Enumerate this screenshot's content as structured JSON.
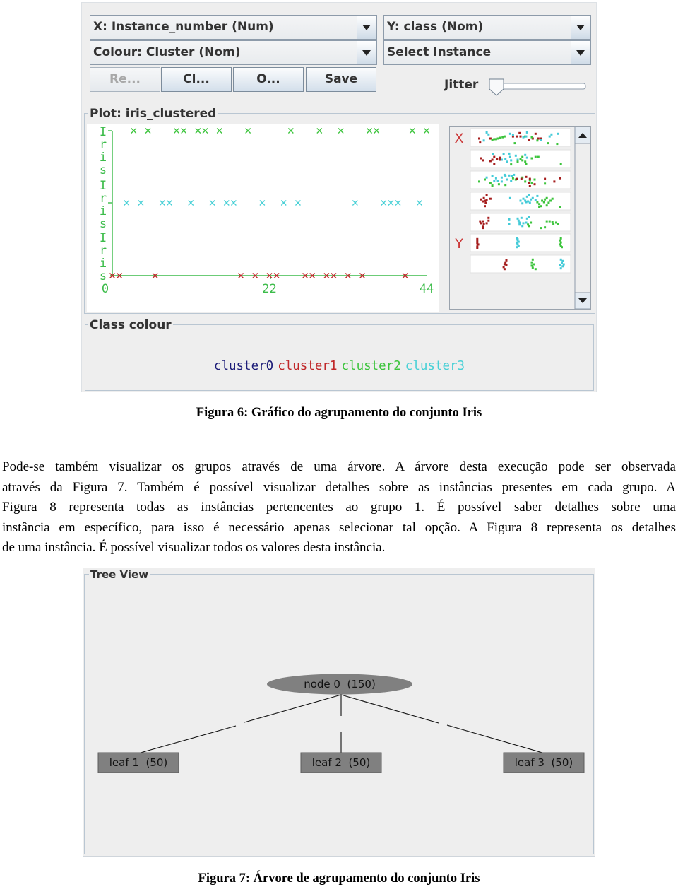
{
  "weka_plot": {
    "x_combo": "X: Instance_number (Num)",
    "y_combo": "Y: class (Nom)",
    "colour_combo": "Colour: Cluster (Nom)",
    "instance_combo": "Select Instance",
    "buttons": {
      "reset": "Re...",
      "clear": "Cl...",
      "open": "O...",
      "save": "Save"
    },
    "jitter_label": "Jitter",
    "jitter_value": 0,
    "plot_title": "Plot: iris_clustered",
    "class_colour_title": "Class colour",
    "legend": [
      {
        "label": "cluster0",
        "color": "#1c1c78"
      },
      {
        "label": "cluster1",
        "color": "#c0282a"
      },
      {
        "label": "cluster2",
        "color": "#3cc43c"
      },
      {
        "label": "cluster3",
        "color": "#48d0d6"
      }
    ]
  },
  "chart_data": {
    "type": "scatter",
    "title": "Plot: iris_clustered",
    "xlabel": "Instance_number",
    "ylabel": "class",
    "xlim": [
      0,
      44
    ],
    "x_ticks": [
      "0",
      "22",
      "44"
    ],
    "y_categories": [
      "Iris",
      "Iris",
      "Iris"
    ],
    "y_categories_order": "bottom-to-top",
    "marker": "x",
    "grid": false,
    "legend": "bottom",
    "series": [
      {
        "name": "cluster1",
        "color": "#c0282a",
        "y_index": 0,
        "x": [
          0,
          1,
          6,
          18,
          20,
          22,
          23,
          27,
          28,
          30,
          31,
          33,
          35,
          41
        ]
      },
      {
        "name": "cluster3",
        "color": "#48d0d6",
        "y_index": 1,
        "x": [
          2,
          4,
          7,
          8,
          11,
          14,
          16,
          17,
          21,
          24,
          26,
          34,
          38,
          39,
          40,
          43
        ]
      },
      {
        "name": "cluster2",
        "color": "#3cc43c",
        "y_index": 2,
        "x": [
          3,
          5,
          9,
          10,
          12,
          13,
          15,
          19,
          25,
          29,
          32,
          36,
          37,
          42,
          44
        ]
      }
    ]
  },
  "matrix": {
    "colors": {
      "1": "#a51d1d",
      "2": "#3cc43c",
      "3": "#44cbd8"
    },
    "strips": [
      {
        "axis_label": "X",
        "points": [
          [
            0.06,
            0.55,
            1
          ],
          [
            0.07,
            0.85,
            1
          ],
          [
            0.18,
            0.55,
            1
          ],
          [
            0.42,
            0.4,
            1
          ],
          [
            0.46,
            0.4,
            1
          ],
          [
            0.5,
            0.4,
            1
          ],
          [
            0.59,
            0.65,
            1
          ],
          [
            0.63,
            0.55,
            1
          ],
          [
            0.66,
            0.2,
            1
          ],
          [
            0.69,
            0.55,
            1
          ],
          [
            0.72,
            0.55,
            1
          ],
          [
            0.49,
            0.15,
            1
          ],
          [
            0.2,
            0.65,
            2
          ],
          [
            0.22,
            0.6,
            2
          ],
          [
            0.24,
            0.6,
            2
          ],
          [
            0.26,
            0.55,
            2
          ],
          [
            0.28,
            0.5,
            2
          ],
          [
            0.31,
            0.45,
            2
          ],
          [
            0.33,
            0.4,
            2
          ],
          [
            0.44,
            0.9,
            2
          ],
          [
            0.55,
            0.4,
            2
          ],
          [
            0.62,
            0.45,
            2
          ],
          [
            0.79,
            0.9,
            2
          ],
          [
            0.89,
            0.95,
            2
          ],
          [
            0.68,
            0.7,
            2
          ],
          [
            0.14,
            0.1,
            3
          ],
          [
            0.16,
            0.25,
            3
          ],
          [
            0.11,
            0.7,
            3
          ],
          [
            0.39,
            0.2,
            3
          ],
          [
            0.42,
            0.3,
            3
          ],
          [
            0.57,
            0.1,
            3
          ],
          [
            0.56,
            0.4,
            3
          ],
          [
            0.72,
            0.65,
            3
          ],
          [
            0.81,
            0.4,
            3
          ],
          [
            0.83,
            0.25,
            3
          ],
          [
            0.9,
            0.2,
            3
          ],
          [
            0.53,
            0.45,
            3
          ]
        ]
      },
      {
        "axis_label": "",
        "points": [
          [
            0.08,
            0.45,
            1
          ],
          [
            0.1,
            0.6,
            1
          ],
          [
            0.18,
            0.65,
            1
          ],
          [
            0.2,
            0.55,
            1
          ],
          [
            0.22,
            0.35,
            1
          ],
          [
            0.25,
            0.5,
            1
          ],
          [
            0.28,
            0.55,
            1
          ],
          [
            0.22,
            0.85,
            1
          ],
          [
            0.28,
            0.4,
            1
          ],
          [
            0.21,
            0.15,
            3
          ],
          [
            0.32,
            0.15,
            3
          ],
          [
            0.38,
            0.1,
            3
          ],
          [
            0.39,
            0.35,
            3
          ],
          [
            0.34,
            0.5,
            3
          ],
          [
            0.45,
            0.25,
            3
          ],
          [
            0.47,
            0.55,
            3
          ],
          [
            0.55,
            0.2,
            3
          ],
          [
            0.57,
            0.4,
            3
          ],
          [
            0.4,
            0.6,
            3
          ],
          [
            0.36,
            0.7,
            3
          ],
          [
            0.3,
            0.55,
            3
          ],
          [
            0.47,
            0.7,
            2
          ],
          [
            0.52,
            0.6,
            2
          ],
          [
            0.55,
            0.7,
            2
          ],
          [
            0.56,
            0.85,
            2
          ],
          [
            0.52,
            0.35,
            2
          ],
          [
            0.62,
            0.45,
            2
          ],
          [
            0.66,
            0.35,
            2
          ],
          [
            0.69,
            0.35,
            2
          ],
          [
            0.4,
            0.9,
            2
          ],
          [
            0.93,
            0.85,
            2
          ],
          [
            0.5,
            0.5,
            2
          ]
        ]
      },
      {
        "axis_label": "",
        "points": [
          [
            0.06,
            0.6,
            2
          ],
          [
            0.12,
            0.45,
            2
          ],
          [
            0.18,
            0.7,
            2
          ],
          [
            0.27,
            0.8,
            2
          ],
          [
            0.42,
            0.35,
            2
          ],
          [
            0.45,
            0.45,
            2
          ],
          [
            0.52,
            0.3,
            2
          ],
          [
            0.55,
            0.6,
            2
          ],
          [
            0.6,
            0.5,
            2
          ],
          [
            0.62,
            0.7,
            2
          ],
          [
            0.65,
            0.45,
            2
          ],
          [
            0.76,
            0.75,
            2
          ],
          [
            0.2,
            0.9,
            2
          ],
          [
            0.34,
            0.85,
            2
          ],
          [
            0.14,
            0.3,
            3
          ],
          [
            0.2,
            0.2,
            3
          ],
          [
            0.24,
            0.35,
            3
          ],
          [
            0.3,
            0.3,
            3
          ],
          [
            0.33,
            0.1,
            3
          ],
          [
            0.34,
            0.2,
            3
          ],
          [
            0.38,
            0.15,
            3
          ],
          [
            0.43,
            0.1,
            3
          ],
          [
            0.41,
            0.2,
            3
          ],
          [
            0.36,
            0.45,
            3
          ],
          [
            0.3,
            0.6,
            3
          ],
          [
            0.26,
            0.55,
            3
          ],
          [
            0.22,
            0.55,
            3
          ],
          [
            0.4,
            0.55,
            3
          ],
          [
            0.46,
            0.4,
            1
          ],
          [
            0.51,
            0.4,
            1
          ],
          [
            0.56,
            0.25,
            1
          ],
          [
            0.6,
            0.4,
            1
          ],
          [
            0.59,
            0.7,
            1
          ],
          [
            0.76,
            0.4,
            1
          ],
          [
            0.92,
            0.35,
            1
          ],
          [
            0.86,
            0.6,
            1
          ],
          [
            0.6,
            0.95,
            1
          ],
          [
            0.65,
            0.8,
            1
          ]
        ]
      },
      {
        "axis_label": "",
        "points": [
          [
            0.08,
            0.35,
            1
          ],
          [
            0.1,
            0.5,
            1
          ],
          [
            0.12,
            0.45,
            1
          ],
          [
            0.11,
            0.25,
            1
          ],
          [
            0.14,
            0.4,
            1
          ],
          [
            0.13,
            0.6,
            1
          ],
          [
            0.18,
            0.3,
            1
          ],
          [
            0.12,
            0.85,
            1
          ],
          [
            0.14,
            0.05,
            1
          ],
          [
            0.39,
            0.25,
            3
          ],
          [
            0.5,
            0.45,
            3
          ],
          [
            0.53,
            0.3,
            3
          ],
          [
            0.55,
            0.45,
            3
          ],
          [
            0.57,
            0.15,
            3
          ],
          [
            0.59,
            0.05,
            3
          ],
          [
            0.61,
            0.35,
            3
          ],
          [
            0.63,
            0.25,
            3
          ],
          [
            0.52,
            0.65,
            3
          ],
          [
            0.56,
            0.55,
            3
          ],
          [
            0.6,
            0.6,
            3
          ],
          [
            0.66,
            0.4,
            3
          ],
          [
            0.68,
            0.1,
            3
          ],
          [
            0.58,
            0.5,
            3
          ],
          [
            0.68,
            0.55,
            2
          ],
          [
            0.7,
            0.7,
            2
          ],
          [
            0.73,
            0.45,
            2
          ],
          [
            0.75,
            0.55,
            2
          ],
          [
            0.76,
            0.35,
            2
          ],
          [
            0.78,
            0.25,
            2
          ],
          [
            0.8,
            0.6,
            2
          ],
          [
            0.82,
            0.45,
            2
          ],
          [
            0.84,
            0.3,
            2
          ],
          [
            0.72,
            0.85,
            2
          ],
          [
            0.7,
            0.9,
            2
          ],
          [
            0.92,
            0.9,
            2
          ],
          [
            0.78,
            0.8,
            2
          ]
        ]
      },
      {
        "axis_label": "",
        "points": [
          [
            0.07,
            0.4,
            1
          ],
          [
            0.08,
            0.55,
            1
          ],
          [
            0.1,
            0.4,
            1
          ],
          [
            0.11,
            0.6,
            1
          ],
          [
            0.1,
            0.8,
            1
          ],
          [
            0.14,
            0.55,
            1
          ],
          [
            0.16,
            0.35,
            1
          ],
          [
            0.16,
            0.15,
            1
          ],
          [
            0.1,
            0.9,
            1
          ],
          [
            0.38,
            0.25,
            3
          ],
          [
            0.38,
            0.6,
            3
          ],
          [
            0.47,
            0.2,
            3
          ],
          [
            0.48,
            0.35,
            3
          ],
          [
            0.49,
            0.5,
            3
          ],
          [
            0.49,
            0.65,
            3
          ],
          [
            0.51,
            0.15,
            3
          ],
          [
            0.53,
            0.55,
            3
          ],
          [
            0.56,
            0.5,
            3
          ],
          [
            0.57,
            0.2,
            3
          ],
          [
            0.59,
            0.05,
            3
          ],
          [
            0.52,
            0.75,
            3
          ],
          [
            0.58,
            0.65,
            2
          ],
          [
            0.59,
            0.75,
            2
          ],
          [
            0.61,
            0.5,
            2
          ],
          [
            0.78,
            0.4,
            2
          ],
          [
            0.81,
            0.4,
            2
          ],
          [
            0.84,
            0.45,
            2
          ],
          [
            0.85,
            0.6,
            2
          ],
          [
            0.88,
            0.5,
            2
          ],
          [
            0.72,
            0.9,
            2
          ],
          [
            0.76,
            0.85,
            2
          ],
          [
            0.9,
            0.6,
            2
          ]
        ]
      },
      {
        "axis_label": "Y",
        "points": [
          [
            0.04,
            0.2,
            1
          ],
          [
            0.04,
            0.35,
            1
          ],
          [
            0.04,
            0.5,
            1
          ],
          [
            0.05,
            0.6,
            1
          ],
          [
            0.04,
            0.75,
            1
          ],
          [
            0.04,
            0.85,
            1
          ],
          [
            0.46,
            0.15,
            3
          ],
          [
            0.47,
            0.3,
            3
          ],
          [
            0.48,
            0.4,
            3
          ],
          [
            0.46,
            0.5,
            3
          ],
          [
            0.47,
            0.6,
            3
          ],
          [
            0.48,
            0.7,
            3
          ],
          [
            0.46,
            0.8,
            3
          ],
          [
            0.47,
            0.22,
            3
          ],
          [
            0.93,
            0.15,
            2
          ],
          [
            0.92,
            0.3,
            2
          ],
          [
            0.93,
            0.45,
            2
          ],
          [
            0.92,
            0.6,
            2
          ],
          [
            0.93,
            0.7,
            2
          ],
          [
            0.94,
            0.8,
            2
          ]
        ]
      },
      {
        "axis_label": "",
        "points": [
          [
            0.35,
            0.2,
            1
          ],
          [
            0.34,
            0.35,
            1
          ],
          [
            0.33,
            0.5,
            1
          ],
          [
            0.35,
            0.55,
            1
          ],
          [
            0.32,
            0.7,
            1
          ],
          [
            0.33,
            0.85,
            1
          ],
          [
            0.63,
            0.15,
            2
          ],
          [
            0.62,
            0.35,
            2
          ],
          [
            0.64,
            0.5,
            2
          ],
          [
            0.62,
            0.6,
            2
          ],
          [
            0.63,
            0.75,
            2
          ],
          [
            0.66,
            0.85,
            2
          ],
          [
            0.93,
            0.15,
            3
          ],
          [
            0.95,
            0.25,
            3
          ],
          [
            0.94,
            0.4,
            3
          ],
          [
            0.92,
            0.55,
            3
          ],
          [
            0.95,
            0.65,
            3
          ],
          [
            0.93,
            0.8,
            3
          ],
          [
            0.96,
            0.5,
            3
          ]
        ]
      }
    ]
  },
  "document": {
    "figure6_caption": "Figura 6: Gráfico do agrupamento do conjunto Iris",
    "paragraph_lines": [
      "Pode-se também visualizar os grupos através de uma árvore. A árvore desta execução pode ser observada",
      "através da Figura 7. Também é possível visualizar detalhes sobre as instâncias presentes em cada grupo. A",
      "Figura 8 representa todas as instâncias pertencentes ao grupo 1. É possível saber detalhes sobre uma",
      "instância em específico, para isso é necessário apenas selecionar tal opção. A Figura 8 representa os detalhes",
      "de uma instância. É possível visualizar todos os valores desta instância."
    ],
    "figure7_caption": "Figura 7: Árvore de agrupamento do conjunto Iris"
  },
  "tree_view": {
    "title": "Tree View",
    "root": {
      "label": "node 0  (150)",
      "color": "#808080"
    },
    "leaves": [
      {
        "label": "leaf 1  (50)"
      },
      {
        "label": "leaf 2  (50)"
      },
      {
        "label": "leaf 3  (50)"
      }
    ]
  }
}
